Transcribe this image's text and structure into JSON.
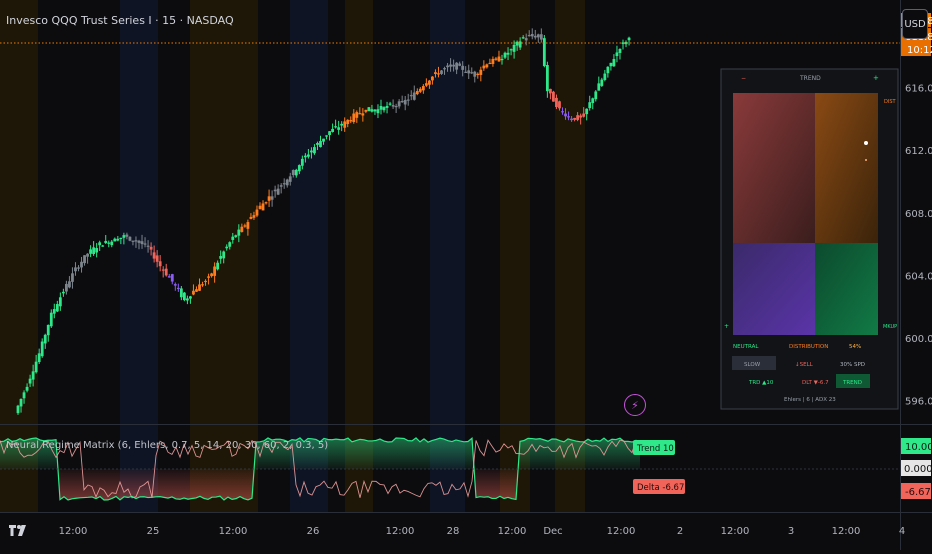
{
  "header": {
    "symbol_title": "Invesco QQQ Trust Series I · 15 · NASDAQ",
    "currency_button": "USD"
  },
  "indicator": {
    "title": "Neural Regime Matrix (6, Ehlers, 0.7, 5, 14, 20, 30, 60, 2, 0.3, 5)"
  },
  "colors": {
    "bull": "#2ee88a",
    "bear": "#f0645a",
    "neutral": "#7d848c",
    "orange": "#ff7d1f",
    "purple": "#8b5cf6",
    "price_tag": "#f57c00"
  },
  "icons": {
    "alert": "lightning-icon",
    "logo": "tradingview-logo-icon"
  },
  "chart_data": [
    {
      "type": "candlestick",
      "y_ticks": [
        "596.00",
        "600.00",
        "604.00",
        "608.00",
        "612.00",
        "616.00"
      ],
      "ylim": [
        594.5,
        621.6
      ],
      "x_ticks": [
        "12:00",
        "25",
        "12:00",
        "26",
        "12:00",
        "28",
        "12:00",
        "Dec",
        "12:00",
        "2",
        "12:00",
        "3",
        "12:00",
        "4"
      ],
      "price_line": 618.85,
      "price_labels": [
        "618.85",
        "618.85",
        "10:12"
      ],
      "path_points": [
        [
          0,
          595.2
        ],
        [
          2,
          597
        ],
        [
          4,
          599
        ],
        [
          6,
          601.5
        ],
        [
          8,
          603
        ],
        [
          10,
          604.4
        ],
        [
          12,
          605.4
        ],
        [
          14,
          606
        ],
        [
          16,
          606.2
        ],
        [
          18,
          606.5
        ],
        [
          20,
          606.2
        ],
        [
          22,
          605.8
        ],
        [
          24,
          604.6
        ],
        [
          26,
          603.6
        ],
        [
          28,
          602.4
        ],
        [
          30,
          603.2
        ],
        [
          32,
          603.8
        ],
        [
          34,
          605.2
        ],
        [
          36,
          606.4
        ],
        [
          38,
          607.2
        ],
        [
          40,
          608.2
        ],
        [
          42,
          609
        ],
        [
          44,
          609.8
        ],
        [
          46,
          610.6
        ],
        [
          48,
          611.6
        ],
        [
          50,
          612.4
        ],
        [
          52,
          613.2
        ],
        [
          54,
          613.6
        ],
        [
          56,
          614.2
        ],
        [
          58,
          614.6
        ],
        [
          60,
          614.6
        ],
        [
          62,
          614.8
        ],
        [
          64,
          615
        ],
        [
          66,
          615.6
        ],
        [
          68,
          616.4
        ],
        [
          70,
          617
        ],
        [
          72,
          617.4
        ],
        [
          74,
          617.2
        ],
        [
          76,
          616.8
        ],
        [
          78,
          617.6
        ],
        [
          80,
          617.8
        ],
        [
          82,
          618.4
        ],
        [
          84,
          619.2
        ],
        [
          86,
          619.3
        ],
        [
          87,
          619.1
        ],
        [
          88,
          615.8
        ],
        [
          90,
          614.6
        ],
        [
          92,
          614
        ],
        [
          94,
          614.2
        ],
        [
          96,
          615.8
        ],
        [
          98,
          617.2
        ],
        [
          100,
          618.6
        ],
        [
          101,
          619
        ]
      ],
      "color_segments": [
        {
          "from": 0,
          "to": 8,
          "color": "bull"
        },
        {
          "from": 8,
          "to": 12,
          "color": "neutral"
        },
        {
          "from": 12,
          "to": 18,
          "color": "bull"
        },
        {
          "from": 18,
          "to": 22,
          "color": "neutral"
        },
        {
          "from": 22,
          "to": 25,
          "color": "bear"
        },
        {
          "from": 25,
          "to": 27,
          "color": "purple"
        },
        {
          "from": 27,
          "to": 29,
          "color": "bull"
        },
        {
          "from": 29,
          "to": 33,
          "color": "orange"
        },
        {
          "from": 33,
          "to": 37,
          "color": "bull"
        },
        {
          "from": 37,
          "to": 42,
          "color": "orange"
        },
        {
          "from": 42,
          "to": 46,
          "color": "neutral"
        },
        {
          "from": 46,
          "to": 54,
          "color": "bull"
        },
        {
          "from": 54,
          "to": 58,
          "color": "orange"
        },
        {
          "from": 58,
          "to": 62,
          "color": "bull"
        },
        {
          "from": 62,
          "to": 66,
          "color": "neutral"
        },
        {
          "from": 66,
          "to": 70,
          "color": "orange"
        },
        {
          "from": 70,
          "to": 76,
          "color": "neutral"
        },
        {
          "from": 76,
          "to": 80,
          "color": "orange"
        },
        {
          "from": 80,
          "to": 84,
          "color": "bull"
        },
        {
          "from": 84,
          "to": 87,
          "color": "neutral"
        },
        {
          "from": 88,
          "to": 90,
          "color": "bear"
        },
        {
          "from": 90,
          "to": 92,
          "color": "purple"
        },
        {
          "from": 92,
          "to": 94,
          "color": "bear"
        },
        {
          "from": 94,
          "to": 101,
          "color": "bull"
        }
      ]
    },
    {
      "type": "line",
      "series": [
        {
          "name": "Trend",
          "last": "10.00",
          "label": "Trend 10"
        },
        {
          "name": "Delta",
          "last": "-6.67",
          "label": "Delta -6.67"
        }
      ],
      "zero_label": "0.0000"
    }
  ],
  "regime_panel": {
    "title": "TREND",
    "minus": "−",
    "plus": "+",
    "top_right_label": "DIST",
    "bottom_right_label": "MKUP",
    "bottom_left_plus": "+",
    "quadrants": [
      "NEUTRAL",
      "DISTRIBUTION",
      "54%"
    ],
    "row1": [
      "SLOW",
      "↓SELL",
      "30% SPD"
    ],
    "row2": [
      "TRD ▲10",
      "DLT ▼-6.7",
      "TREND"
    ],
    "footer": "Ehlers | 6 | ADX 23"
  }
}
